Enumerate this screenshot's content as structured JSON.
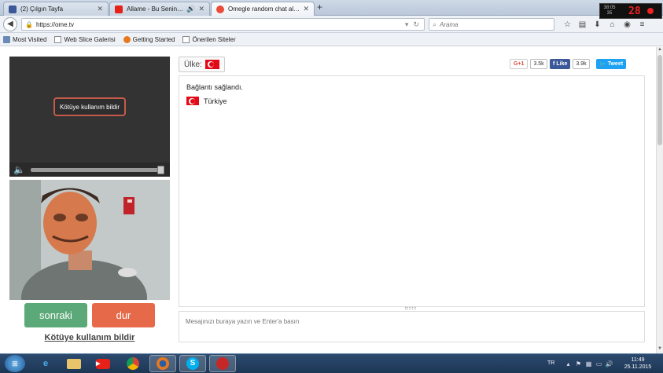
{
  "browser": {
    "tabs": [
      {
        "title": "(2) Çılgın Tayfa",
        "favicon_color": "#3b5998",
        "active": false
      },
      {
        "title": "Allame - Bu Senin Elleri...",
        "favicon_color": "#e62117",
        "active": false
      },
      {
        "title": "Omegle random chat alter...",
        "favicon_color": "#e94d3a",
        "active": true
      }
    ],
    "new_tab": "+",
    "url": "https://ome.tv",
    "search_placeholder": "Arama",
    "bookmarks": [
      "Most Visited",
      "Web Slice Galerisi",
      "Getting Started",
      "Önerilen Siteler"
    ]
  },
  "recorder": {
    "fps_label": "38:05\n35",
    "count": "28"
  },
  "page": {
    "report_popup": "Kötüye kullanım bildir",
    "next_button": "sonraki",
    "stop_button": "dur",
    "report_link": "Kötüye kullanım bildir",
    "country_label": "Ülke:",
    "social": {
      "gplus_label": "G+1",
      "gplus_count": "3.5k",
      "fb_label": "Like",
      "fb_count": "3.9k",
      "tw_label": "Tweet"
    },
    "chat": {
      "status": "Bağlantı sağlandı.",
      "country_name": "Türkiye"
    },
    "message_placeholder": "Mesajınızı buraya yazın ve Enter'a basın"
  },
  "taskbar": {
    "lang": "TR",
    "time": "11:49",
    "date": "25.11.2015"
  },
  "colors": {
    "next": "#5ba878",
    "stop": "#e66a4a",
    "flag_red": "#e30a17",
    "facebook": "#3b5998",
    "twitter": "#1da1f2",
    "gplus": "#dd4b39"
  }
}
